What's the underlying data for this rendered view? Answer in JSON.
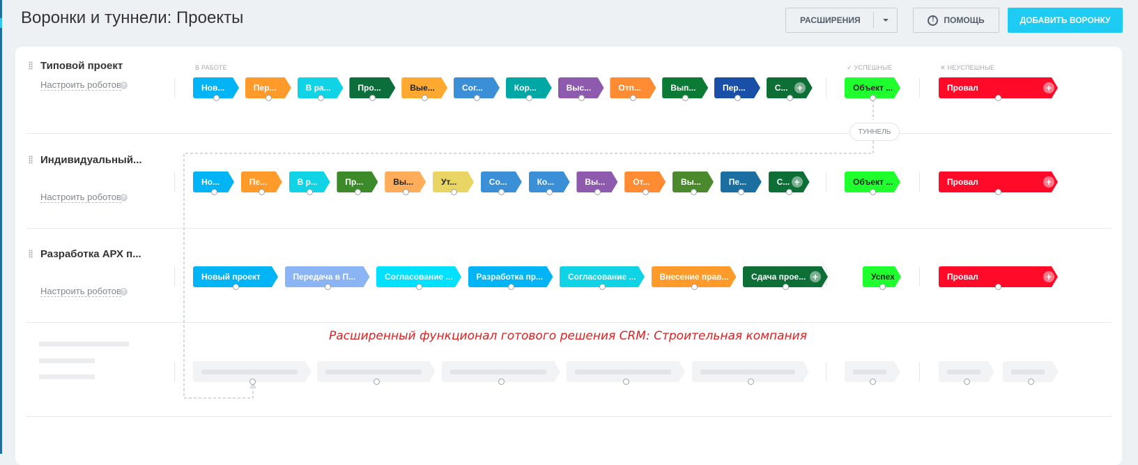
{
  "page": {
    "title": "Воронки и туннели: Проекты",
    "extensions_label": "РАСШИРЕНИЯ",
    "help_label": "ПОМОЩЬ",
    "add_funnel_label": "ДОБАВИТЬ ВОРОНКУ",
    "accent_color": "#1ecbf2"
  },
  "columns": {
    "in_work": "В РАБОТЕ",
    "success": "УСПЕШНЫЕ",
    "fail": "НЕУСПЕШНЫЕ"
  },
  "robots_label": "Настроить роботов",
  "tunnel_label": "ТУННЕЛЬ",
  "promo_text": "Расширенный функционал готового решения CRM: Строительная компания",
  "funnels": [
    {
      "name": "Типовой проект",
      "stages": [
        {
          "label": "Нов...",
          "color": "#00b4f5"
        },
        {
          "label": "Пер...",
          "color": "#ff9a2b"
        },
        {
          "label": "В ра...",
          "color": "#10d4e5"
        },
        {
          "label": "Про...",
          "color": "#0c6e3a"
        },
        {
          "label": "Вые...",
          "color": "#ffa930"
        },
        {
          "label": "Сог...",
          "color": "#3b8fd6"
        },
        {
          "label": "Кор...",
          "color": "#00a8a5"
        },
        {
          "label": "Выс...",
          "color": "#8e5aad"
        },
        {
          "label": "Отп...",
          "color": "#ff8c32"
        },
        {
          "label": "Вып...",
          "color": "#0b7a35"
        },
        {
          "label": "Пер...",
          "color": "#1a4fa8"
        },
        {
          "label": "С...",
          "color": "#0d6e36"
        }
      ],
      "success": "Объект ...",
      "fail": "Провал"
    },
    {
      "name": "Индивидуальный...",
      "stages": [
        {
          "label": "Но...",
          "color": "#00b4f5"
        },
        {
          "label": "Пе...",
          "color": "#ff9a2b"
        },
        {
          "label": "В р...",
          "color": "#10d4e5"
        },
        {
          "label": "Пр...",
          "color": "#3d8a2a"
        },
        {
          "label": "Вы...",
          "color": "#ffad5a"
        },
        {
          "label": "Ут...",
          "color": "#e8d564"
        },
        {
          "label": "Со...",
          "color": "#3b8fd6"
        },
        {
          "label": "Ко...",
          "color": "#3b8fd6"
        },
        {
          "label": "Вы...",
          "color": "#8e5aad"
        },
        {
          "label": "От...",
          "color": "#ff8c32"
        },
        {
          "label": "Вы...",
          "color": "#4a8a2c"
        },
        {
          "label": "Пе...",
          "color": "#1a6fa0"
        },
        {
          "label": "С...",
          "color": "#0d6e36"
        }
      ],
      "success": "Объект ...",
      "fail": "Провал"
    },
    {
      "name": "Разработка АРХ п...",
      "stages": [
        {
          "label": "Новый проект",
          "color": "#00b4f5"
        },
        {
          "label": "Передача в П...",
          "color": "#8bb4f5"
        },
        {
          "label": "Согласование ...",
          "color": "#00e0ff"
        },
        {
          "label": "Разработка пр...",
          "color": "#00b4f5"
        },
        {
          "label": "Согласование ...",
          "color": "#10d4e5"
        },
        {
          "label": "Внесение прав...",
          "color": "#ff9a2b"
        },
        {
          "label": "Сдача прое...",
          "color": "#0d6e36"
        }
      ],
      "success": "Успех",
      "fail": "Провал"
    }
  ]
}
